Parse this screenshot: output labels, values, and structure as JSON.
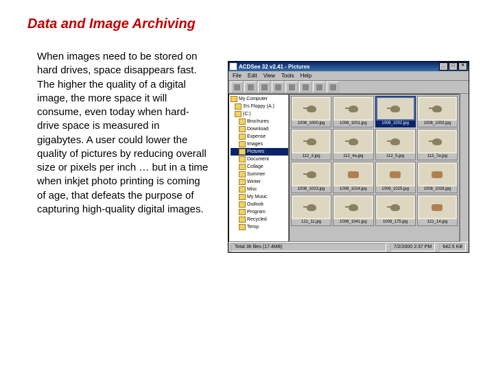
{
  "title": "Data and Image Archiving",
  "paragraph": "When images need to be stored on hard drives, space disappears fast. The higher the quality of a digital image, the more space it will consume, even today when hard-drive space is measured in gigabytes. A user could lower the quality of pictures by reducing overall size or pixels per inch … but in a time when inkjet photo printing is coming of age, that defeats the purpose of capturing high-quality digital images.",
  "app": {
    "title": "ACDSee 32 v2.41 - Pictures",
    "winbuttons": [
      "_",
      "□",
      "×"
    ],
    "menu": [
      "File",
      "Edit",
      "View",
      "Tools",
      "Help"
    ],
    "tree": [
      {
        "label": "My Computer",
        "indent": 0
      },
      {
        "label": "3½ Floppy (A:)",
        "indent": 1
      },
      {
        "label": "(C:)",
        "indent": 1
      },
      {
        "label": "Brochures",
        "indent": 2
      },
      {
        "label": "Download",
        "indent": 2
      },
      {
        "label": "Expense",
        "indent": 2
      },
      {
        "label": "Images",
        "indent": 2
      },
      {
        "label": "Pictures",
        "indent": 2,
        "selected": true
      },
      {
        "label": "Document",
        "indent": 2
      },
      {
        "label": "Collage",
        "indent": 2
      },
      {
        "label": "Summer",
        "indent": 2
      },
      {
        "label": "Winter",
        "indent": 2
      },
      {
        "label": "Misc",
        "indent": 2
      },
      {
        "label": "My Music",
        "indent": 2
      },
      {
        "label": "Outlook",
        "indent": 2
      },
      {
        "label": "Program",
        "indent": 2
      },
      {
        "label": "Recycled",
        "indent": 2
      },
      {
        "label": "Temp",
        "indent": 2
      }
    ],
    "thumbs": [
      {
        "cap": "1008_1000.jpg",
        "style": "bird"
      },
      {
        "cap": "1008_1001.jpg",
        "style": "bird"
      },
      {
        "cap": "1008_1002.jpg",
        "style": "bird",
        "selected": true
      },
      {
        "cap": "1008_1003.jpg",
        "style": "bird"
      },
      {
        "cap": "112_3.jpg",
        "style": "bird"
      },
      {
        "cap": "112_4a.jpg",
        "style": "bird"
      },
      {
        "cap": "112_5.jpg",
        "style": "bird"
      },
      {
        "cap": "112_7a.jpg",
        "style": "bird"
      },
      {
        "cap": "1008_1023.jpg",
        "style": "bird"
      },
      {
        "cap": "1008_1024.jpg",
        "style": "hand"
      },
      {
        "cap": "1008_1025.jpg",
        "style": "hand"
      },
      {
        "cap": "1008_1026.jpg",
        "style": "hand"
      },
      {
        "cap": "121_11.jpg",
        "style": "bird"
      },
      {
        "cap": "1008_1041.jpg",
        "style": "bird"
      },
      {
        "cap": "1008_175.jpg",
        "style": "bird"
      },
      {
        "cap": "121_14.jpg",
        "style": "hand"
      }
    ],
    "status": {
      "left": "Total 36 files (17.4MB)",
      "mid": "7/2/2000 2:37 PM",
      "right": "642.5 KB"
    }
  }
}
